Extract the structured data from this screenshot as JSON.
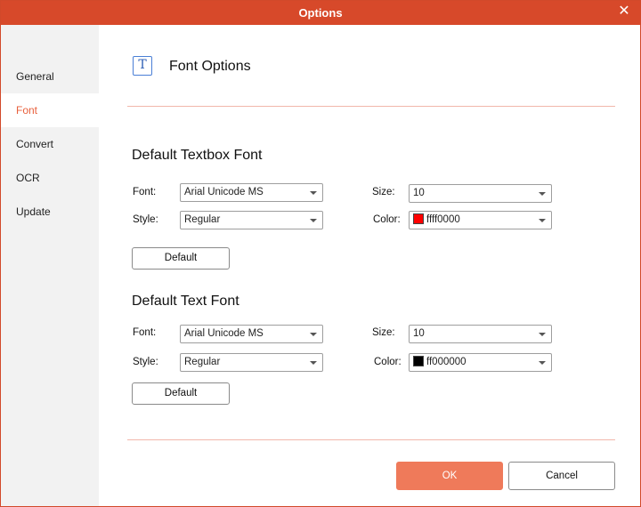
{
  "window": {
    "title": "Options",
    "close_glyph": "✕"
  },
  "sidebar": {
    "items": [
      {
        "label": "General"
      },
      {
        "label": "Font"
      },
      {
        "label": "Convert"
      },
      {
        "label": "OCR"
      },
      {
        "label": "Update"
      }
    ],
    "active": "Font"
  },
  "header": {
    "icon": "text-t-icon",
    "icon_glyph": "T",
    "title": "Font Options"
  },
  "textbox_section": {
    "title": "Default Textbox Font",
    "font_label": "Font:",
    "font_value": "Arial Unicode MS",
    "size_label": "Size:",
    "size_value": "10",
    "style_label": "Style:",
    "style_value": "Regular",
    "color_label": "Color:",
    "color_value": "ffff0000",
    "color_swatch": "#ff0000",
    "default_label": "Default"
  },
  "text_section": {
    "title": "Default Text Font",
    "font_label": "Font:",
    "font_value": "Arial Unicode MS",
    "size_label": "Size:",
    "size_value": "10",
    "style_label": "Style:",
    "style_value": "Regular",
    "color_label": "Color:",
    "color_value": "ff000000",
    "color_swatch": "#000000",
    "default_label": "Default"
  },
  "footer": {
    "ok_label": "OK",
    "cancel_label": "Cancel"
  },
  "colors": {
    "accent": "#d7492a",
    "primary_button": "#ef7a5a",
    "active_nav_text": "#e8603c",
    "sidebar_bg": "#f2f2f2"
  }
}
